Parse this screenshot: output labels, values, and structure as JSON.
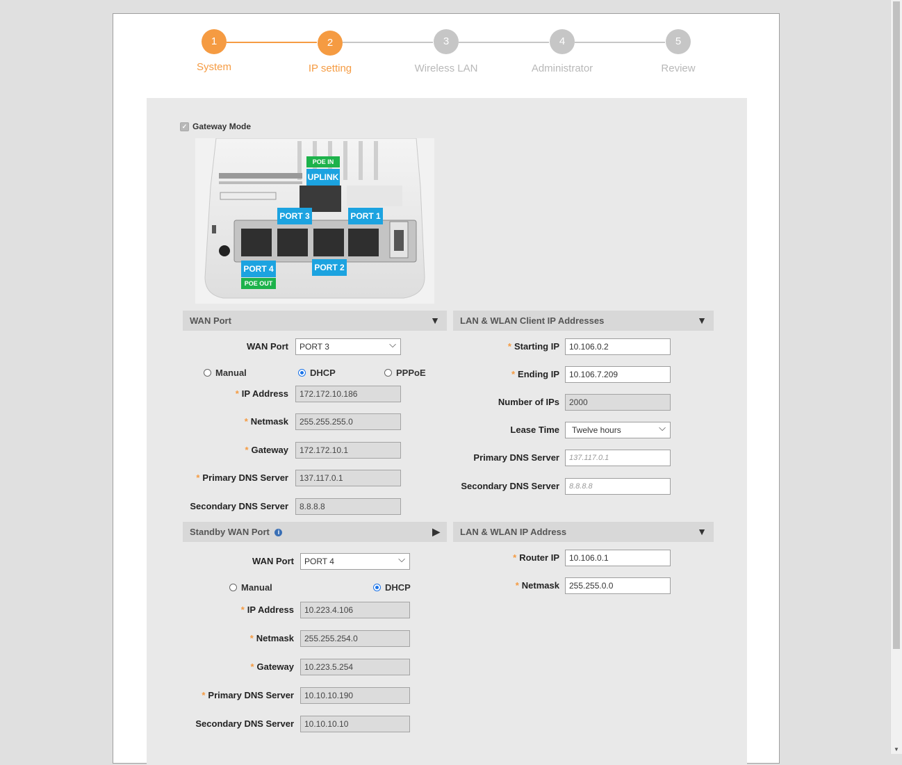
{
  "wizard": {
    "steps": [
      {
        "num": "1",
        "label": "System"
      },
      {
        "num": "2",
        "label": "IP setting"
      },
      {
        "num": "3",
        "label": "Wireless LAN"
      },
      {
        "num": "4",
        "label": "Administrator"
      },
      {
        "num": "5",
        "label": "Review"
      }
    ],
    "active_color": "#f59b42",
    "inactive_color": "#c6c6c6"
  },
  "gateway_mode": {
    "label": "Gateway Mode",
    "checked": true
  },
  "device_image": {
    "labels": {
      "poe_in": "POE IN",
      "uplink": "UPLINK",
      "port3": "PORT 3",
      "port1": "PORT 1",
      "port4": "PORT 4",
      "port2": "PORT 2",
      "poe_out": "POE OUT"
    }
  },
  "wan": {
    "header": "WAN Port",
    "wan_port_label": "WAN Port",
    "wan_port_value": "PORT 3",
    "modes": {
      "manual": "Manual",
      "dhcp": "DHCP",
      "pppoe": "PPPoE"
    },
    "selected_mode": "DHCP",
    "fields": {
      "ip_label": "IP Address",
      "ip_value": "172.172.10.186",
      "netmask_label": "Netmask",
      "netmask_value": "255.255.255.0",
      "gateway_label": "Gateway",
      "gateway_value": "172.172.10.1",
      "pdns_label": "Primary DNS Server",
      "pdns_value": "137.117.0.1",
      "sdns_label": "Secondary DNS Server",
      "sdns_value": "8.8.8.8"
    }
  },
  "standby": {
    "header": "Standby WAN Port",
    "wan_port_label": "WAN Port",
    "wan_port_value": "PORT 4",
    "modes": {
      "manual": "Manual",
      "dhcp": "DHCP"
    },
    "selected_mode": "DHCP",
    "fields": {
      "ip_label": "IP Address",
      "ip_value": "10.223.4.106",
      "netmask_label": "Netmask",
      "netmask_value": "255.255.254.0",
      "gateway_label": "Gateway",
      "gateway_value": "10.223.5.254",
      "pdns_label": "Primary DNS Server",
      "pdns_value": "10.10.10.190",
      "sdns_label": "Secondary DNS Server",
      "sdns_value": "10.10.10.10"
    }
  },
  "lan_client": {
    "header": "LAN & WLAN Client IP Addresses",
    "starting_ip_label": "Starting IP",
    "starting_ip_value": "10.106.0.2",
    "ending_ip_label": "Ending IP",
    "ending_ip_value": "10.106.7.209",
    "num_ips_label": "Number of IPs",
    "num_ips_value": "2000",
    "lease_label": "Lease Time",
    "lease_value": "Twelve hours",
    "pdns_label": "Primary DNS Server",
    "pdns_placeholder": "137.117.0.1",
    "sdns_label": "Secondary DNS Server",
    "sdns_placeholder": "8.8.8.8"
  },
  "lan_ip": {
    "header": "LAN & WLAN IP Address",
    "router_ip_label": "Router IP",
    "router_ip_value": "10.106.0.1",
    "netmask_label": "Netmask",
    "netmask_value": "255.255.0.0"
  }
}
